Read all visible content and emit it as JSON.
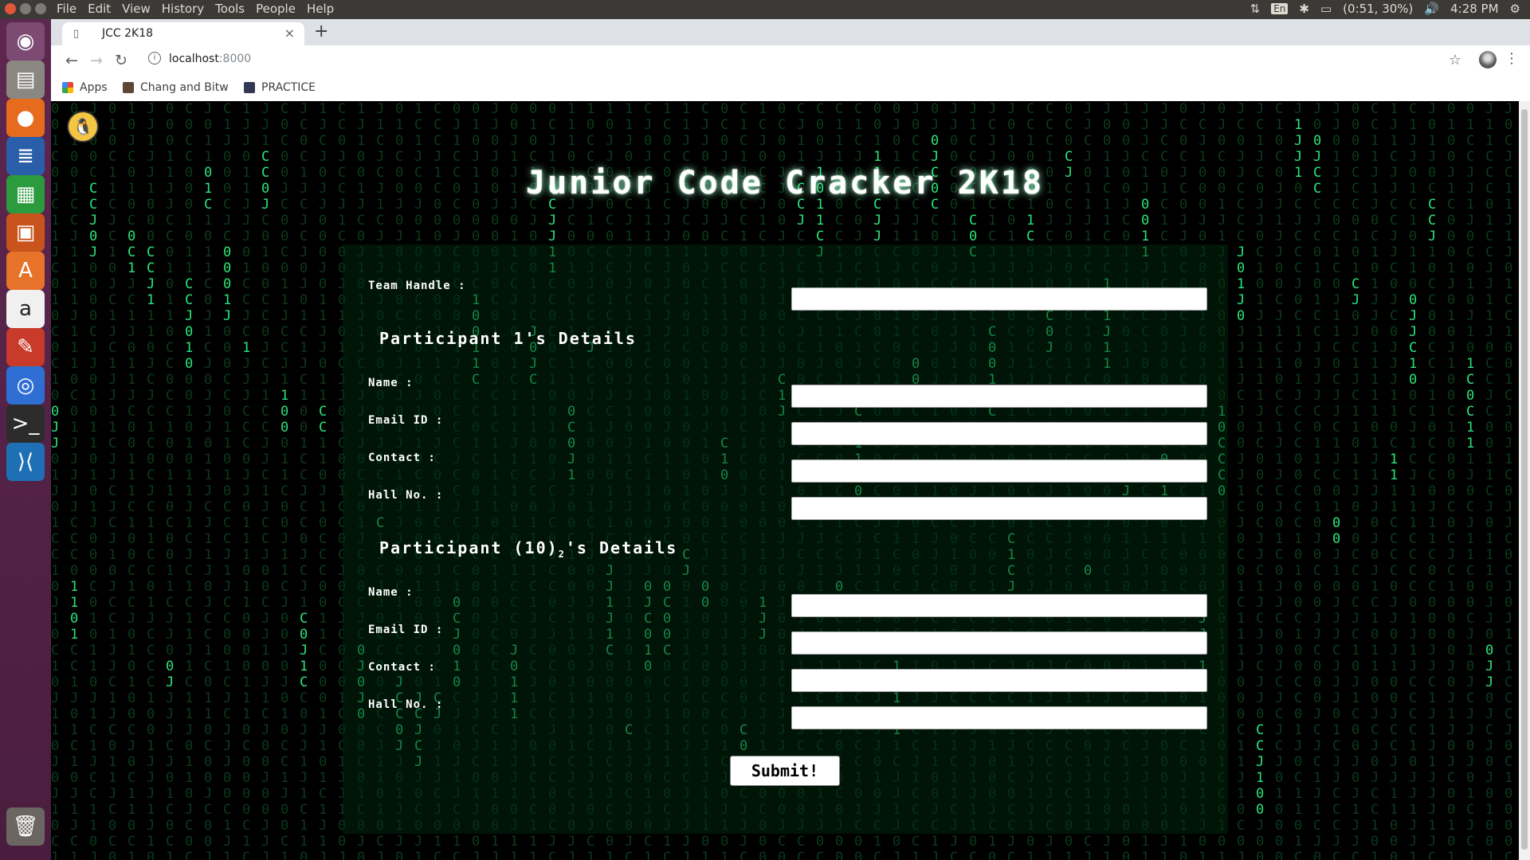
{
  "system": {
    "menus": [
      "File",
      "Edit",
      "View",
      "History",
      "Tools",
      "People",
      "Help"
    ],
    "tray_lang": "En",
    "battery": "(0:51, 30%)",
    "clock": "4:28 PM"
  },
  "browser": {
    "tab_title": "JCC 2K18",
    "url_host": "localhost",
    "url_port": ":8000",
    "bookmarks": [
      "Apps",
      "Chang and Bitw",
      "PRACTICE"
    ]
  },
  "launcher": {
    "icons": [
      "ubuntu-dash-icon",
      "files-icon",
      "firefox-icon",
      "writer-icon",
      "calc-icon",
      "impress-icon",
      "software-center-icon",
      "amazon-icon",
      "settings-icon",
      "chrome-icon",
      "terminal-icon",
      "vscode-icon",
      "trash-icon"
    ]
  },
  "page": {
    "title": "Junior Code Cracker 2K18",
    "team_handle_label": "Team Handle :",
    "p1_heading": "Participant 1's Details",
    "p2_heading_prefix": "Participant (10)",
    "p2_heading_sub": "2",
    "p2_heading_suffix": "'s Details",
    "labels": {
      "name": "Name :",
      "email": "Email ID :",
      "contact": "Contact :",
      "hall": "Hall No. :"
    },
    "fields": {
      "team_handle": "",
      "p1_name": "",
      "p1_email": "",
      "p1_contact": "",
      "p1_hall": "",
      "p2_name": "",
      "p2_email": "",
      "p2_contact": "",
      "p2_hall": ""
    },
    "submit_label": "Submit!"
  },
  "colors": {
    "matrix_bright": "#2be37a",
    "matrix_dim": "#0b3a1a",
    "launcher_bg": "#5e2750"
  }
}
